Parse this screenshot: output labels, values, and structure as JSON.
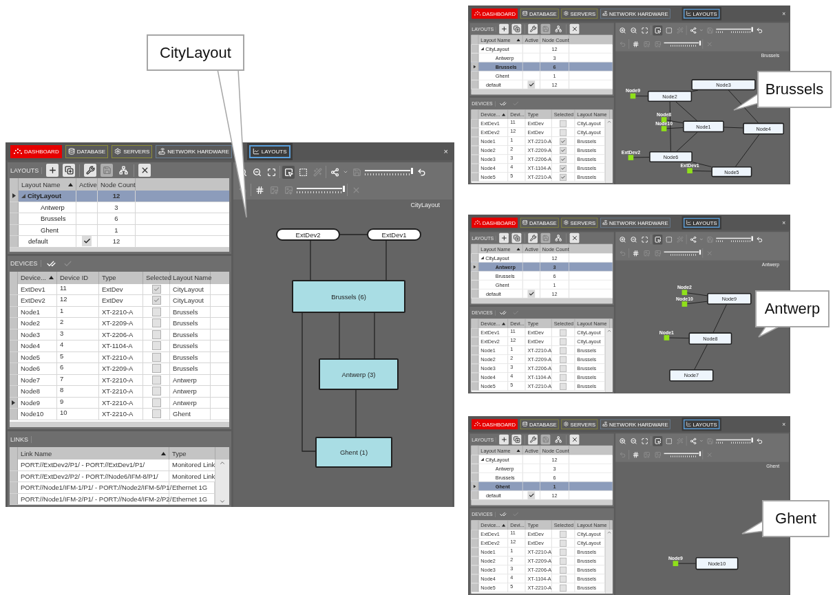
{
  "screenshots": [
    {
      "callout": "CityLayout",
      "window": {
        "tabs": [
          {
            "label": "DASHBOARD",
            "kind": "dashboard",
            "selected": false
          },
          {
            "label": "DATABASE",
            "kind": "database",
            "selected": false
          },
          {
            "label": "SERVERS",
            "kind": "servers",
            "selected": false
          },
          {
            "label": "NETWORK HARDWARE",
            "kind": "hardware",
            "selected": false
          },
          {
            "label": "LAYOUTS",
            "kind": "layouts",
            "selected": true
          }
        ],
        "close": "×",
        "layouts": {
          "title": "LAYOUTS",
          "columns": [
            "Layout Name",
            "Active",
            "Node Count"
          ],
          "rows": [
            {
              "name": "CityLayout",
              "active": false,
              "count": "12",
              "selected": true,
              "expanded": true,
              "children": [
                {
                  "name": "Antwerp",
                  "active": false,
                  "count": "3",
                  "selected": false
                },
                {
                  "name": "Brussels",
                  "active": false,
                  "count": "6",
                  "selected": false
                },
                {
                  "name": "Ghent",
                  "active": false,
                  "count": "1",
                  "selected": false
                }
              ]
            },
            {
              "name": "default",
              "active": true,
              "count": "12",
              "selected": false
            }
          ]
        },
        "devices": {
          "title": "DEVICES",
          "scrollbar": false,
          "columns": [
            "Device...",
            "Device ID",
            "Type",
            "Selected",
            "Layout Name"
          ],
          "rows": [
            {
              "name": "ExtDev1",
              "id": "11",
              "type": "ExtDev",
              "checked": true,
              "layout": "CityLayout",
              "current": false
            },
            {
              "name": "ExtDev2",
              "id": "12",
              "type": "ExtDev",
              "checked": true,
              "layout": "CityLayout",
              "current": false
            },
            {
              "name": "Node1",
              "id": "1",
              "type": "XT-2210-A",
              "checked": false,
              "layout": "Brussels",
              "current": false
            },
            {
              "name": "Node2",
              "id": "2",
              "type": "XT-2209-A",
              "checked": false,
              "layout": "Brussels",
              "current": false
            },
            {
              "name": "Node3",
              "id": "3",
              "type": "XT-2206-A",
              "checked": false,
              "layout": "Brussels",
              "current": false
            },
            {
              "name": "Node4",
              "id": "4",
              "type": "XT-1104-A",
              "checked": false,
              "layout": "Brussels",
              "current": false
            },
            {
              "name": "Node5",
              "id": "5",
              "type": "XT-2210-A",
              "checked": false,
              "layout": "Brussels",
              "current": false
            },
            {
              "name": "Node6",
              "id": "6",
              "type": "XT-2209-A",
              "checked": false,
              "layout": "Brussels",
              "current": false
            },
            {
              "name": "Node7",
              "id": "7",
              "type": "XT-2210-A",
              "checked": false,
              "layout": "Antwerp",
              "current": false
            },
            {
              "name": "Node8",
              "id": "8",
              "type": "XT-2210-A",
              "checked": false,
              "layout": "Antwerp",
              "current": false
            },
            {
              "name": "Node9",
              "id": "9",
              "type": "XT-2210-A",
              "checked": false,
              "layout": "Antwerp",
              "current": true
            },
            {
              "name": "Node10",
              "id": "10",
              "type": "XT-2210-A",
              "checked": false,
              "layout": "Ghent",
              "current": false
            }
          ]
        },
        "links": {
          "title": "LINKS",
          "columns": [
            "Link Name",
            "Type"
          ],
          "rows": [
            {
              "name": "PORT://ExtDev2/P1/ - PORT://ExtDev1/P1/",
              "type": "Monitored Link"
            },
            {
              "name": "PORT://ExtDev2/P2/ - PORT://Node6/IFM-8/P1/",
              "type": "Monitored Link"
            },
            {
              "name": "PORT://Node1/IFM-1/P1/ - PORT://Node2/IFM-5/P1/",
              "type": "Ethernet 1G"
            },
            {
              "name": "PORT://Node1/IFM-2/P1/ - PORT://Node4/IFM-2/P2/",
              "type": "Ethernet 1G"
            }
          ]
        },
        "canvas": {
          "title": "CityLayout",
          "zoom": {
            "level": 1
          },
          "size": {
            "level": 1
          },
          "nodes": [
            {
              "label": "ExtDev2",
              "kind": "pill"
            },
            {
              "label": "ExtDev1",
              "kind": "pill"
            },
            {
              "label": "Brussels (6)",
              "kind": "group"
            },
            {
              "label": "Antwerp (3)",
              "kind": "group"
            },
            {
              "label": "Ghent (1)",
              "kind": "group"
            }
          ]
        }
      }
    },
    {
      "callout": "Brussels",
      "window": {
        "tabs": [
          {
            "label": "DASHBOARD",
            "kind": "dashboard",
            "selected": false
          },
          {
            "label": "DATABASE",
            "kind": "database",
            "selected": false
          },
          {
            "label": "SERVERS",
            "kind": "servers",
            "selected": false
          },
          {
            "label": "NETWORK HARDWARE",
            "kind": "hardware",
            "selected": false
          },
          {
            "label": "LAYOUTS",
            "kind": "layouts",
            "selected": true
          }
        ],
        "close": "×",
        "layouts": {
          "title": "LAYOUTS",
          "columns": [
            "Layout Name",
            "Active",
            "Node Count"
          ],
          "rows": [
            {
              "name": "CityLayout",
              "active": false,
              "count": "12",
              "selected": false,
              "expanded": true,
              "children": [
                {
                  "name": "Antwerp",
                  "active": false,
                  "count": "3",
                  "selected": false
                },
                {
                  "name": "Brussels",
                  "active": false,
                  "count": "6",
                  "selected": true
                },
                {
                  "name": "Ghent",
                  "active": false,
                  "count": "1",
                  "selected": false
                }
              ]
            },
            {
              "name": "default",
              "active": true,
              "count": "12",
              "selected": false
            }
          ]
        },
        "devices": {
          "title": "DEVICES",
          "scrollbar": true,
          "columns": [
            "Device...",
            "Devi...",
            "Type",
            "Selected",
            "Layout Name"
          ],
          "rows": [
            {
              "name": "ExtDev1",
              "id": "11",
              "type": "ExtDev",
              "checked": false,
              "layout": "CityLayout",
              "current": false
            },
            {
              "name": "ExtDev2",
              "id": "12",
              "type": "ExtDev",
              "checked": false,
              "layout": "CityLayout",
              "current": false
            },
            {
              "name": "Node1",
              "id": "1",
              "type": "XT-2210-A",
              "checked": true,
              "layout": "Brussels",
              "current": false
            },
            {
              "name": "Node2",
              "id": "2",
              "type": "XT-2209-A",
              "checked": true,
              "layout": "Brussels",
              "current": false
            },
            {
              "name": "Node3",
              "id": "3",
              "type": "XT-2206-A",
              "checked": true,
              "layout": "Brussels",
              "current": false
            },
            {
              "name": "Node4",
              "id": "4",
              "type": "XT-1104-A",
              "checked": true,
              "layout": "Brussels",
              "current": false
            },
            {
              "name": "Node5",
              "id": "5",
              "type": "XT-2210-A",
              "checked": true,
              "layout": "Brussels",
              "current": false
            }
          ]
        },
        "canvas": {
          "title": "Brussels",
          "zoom": {
            "level": 1
          },
          "size": {
            "level": 1
          },
          "nodes": [
            {
              "label": "Node3",
              "kind": "node"
            },
            {
              "label": "Node9",
              "kind": "port"
            },
            {
              "label": "Node2",
              "kind": "node"
            },
            {
              "label": "Node8",
              "kind": "port"
            },
            {
              "label": "Node10",
              "kind": "port"
            },
            {
              "label": "Node1",
              "kind": "node"
            },
            {
              "label": "Node4",
              "kind": "node"
            },
            {
              "label": "ExtDev2",
              "kind": "port"
            },
            {
              "label": "Node6",
              "kind": "node"
            },
            {
              "label": "ExtDev1",
              "kind": "port"
            },
            {
              "label": "Node5",
              "kind": "node"
            }
          ]
        }
      }
    },
    {
      "callout": "Antwerp",
      "window": {
        "tabs": [
          {
            "label": "DASHBOARD",
            "kind": "dashboard",
            "selected": false
          },
          {
            "label": "DATABASE",
            "kind": "database",
            "selected": false
          },
          {
            "label": "SERVERS",
            "kind": "servers",
            "selected": false
          },
          {
            "label": "NETWORK HARDWARE",
            "kind": "hardware",
            "selected": false
          },
          {
            "label": "LAYOUTS",
            "kind": "layouts",
            "selected": true
          }
        ],
        "close": "×",
        "layouts": {
          "title": "LAYOUTS",
          "columns": [
            "Layout Name",
            "Active",
            "Node Count"
          ],
          "rows": [
            {
              "name": "CityLayout",
              "active": false,
              "count": "12",
              "selected": false,
              "expanded": true,
              "children": [
                {
                  "name": "Antwerp",
                  "active": false,
                  "count": "3",
                  "selected": true
                },
                {
                  "name": "Brussels",
                  "active": false,
                  "count": "6",
                  "selected": false
                },
                {
                  "name": "Ghent",
                  "active": false,
                  "count": "1",
                  "selected": false
                }
              ]
            },
            {
              "name": "default",
              "active": true,
              "count": "12",
              "selected": false
            }
          ]
        },
        "devices": {
          "title": "DEVICES",
          "scrollbar": true,
          "columns": [
            "Device...",
            "Devi...",
            "Type",
            "Selected",
            "Layout Name"
          ],
          "rows": [
            {
              "name": "ExtDev1",
              "id": "11",
              "type": "ExtDev",
              "checked": false,
              "layout": "CityLayout",
              "current": false
            },
            {
              "name": "ExtDev2",
              "id": "12",
              "type": "ExtDev",
              "checked": false,
              "layout": "CityLayout",
              "current": false
            },
            {
              "name": "Node1",
              "id": "1",
              "type": "XT-2210-A",
              "checked": false,
              "layout": "Brussels",
              "current": false
            },
            {
              "name": "Node2",
              "id": "2",
              "type": "XT-2209-A",
              "checked": false,
              "layout": "Brussels",
              "current": false
            },
            {
              "name": "Node3",
              "id": "3",
              "type": "XT-2206-A",
              "checked": false,
              "layout": "Brussels",
              "current": false
            },
            {
              "name": "Node4",
              "id": "4",
              "type": "XT-1104-A",
              "checked": false,
              "layout": "Brussels",
              "current": false
            },
            {
              "name": "Node5",
              "id": "5",
              "type": "XT-2210-A",
              "checked": false,
              "layout": "Brussels",
              "current": false
            }
          ]
        },
        "canvas": {
          "title": "Antwerp",
          "zoom": {
            "level": 1
          },
          "size": {
            "level": 1
          },
          "nodes": [
            {
              "label": "Node2",
              "kind": "port"
            },
            {
              "label": "Node10",
              "kind": "port"
            },
            {
              "label": "Node9",
              "kind": "node"
            },
            {
              "label": "Node1",
              "kind": "port"
            },
            {
              "label": "Node8",
              "kind": "node"
            },
            {
              "label": "Node7",
              "kind": "node"
            }
          ]
        }
      }
    },
    {
      "callout": "Ghent",
      "window": {
        "tabs": [
          {
            "label": "DASHBOARD",
            "kind": "dashboard",
            "selected": false
          },
          {
            "label": "DATABASE",
            "kind": "database",
            "selected": false
          },
          {
            "label": "SERVERS",
            "kind": "servers",
            "selected": false
          },
          {
            "label": "NETWORK HARDWARE",
            "kind": "hardware",
            "selected": false
          },
          {
            "label": "LAYOUTS",
            "kind": "layouts",
            "selected": true
          }
        ],
        "close": "×",
        "layouts": {
          "title": "LAYOUTS",
          "columns": [
            "Layout Name",
            "Active",
            "Node Count"
          ],
          "rows": [
            {
              "name": "CityLayout",
              "active": false,
              "count": "12",
              "selected": false,
              "expanded": true,
              "children": [
                {
                  "name": "Antwerp",
                  "active": false,
                  "count": "3",
                  "selected": false
                },
                {
                  "name": "Brussels",
                  "active": false,
                  "count": "6",
                  "selected": false
                },
                {
                  "name": "Ghent",
                  "active": false,
                  "count": "1",
                  "selected": true
                }
              ]
            },
            {
              "name": "default",
              "active": true,
              "count": "12",
              "selected": false
            }
          ]
        },
        "devices": {
          "title": "DEVICES",
          "scrollbar": true,
          "columns": [
            "Device...",
            "Devi...",
            "Type",
            "Selected",
            "Layout Name"
          ],
          "rows": [
            {
              "name": "ExtDev1",
              "id": "11",
              "type": "ExtDev",
              "checked": false,
              "layout": "CityLayout",
              "current": false
            },
            {
              "name": "ExtDev2",
              "id": "12",
              "type": "ExtDev",
              "checked": false,
              "layout": "CityLayout",
              "current": false
            },
            {
              "name": "Node1",
              "id": "1",
              "type": "XT-2210-A",
              "checked": false,
              "layout": "Brussels",
              "current": false
            },
            {
              "name": "Node2",
              "id": "2",
              "type": "XT-2209-A",
              "checked": false,
              "layout": "Brussels",
              "current": false
            },
            {
              "name": "Node3",
              "id": "3",
              "type": "XT-2206-A",
              "checked": false,
              "layout": "Brussels",
              "current": false
            },
            {
              "name": "Node4",
              "id": "4",
              "type": "XT-1104-A",
              "checked": false,
              "layout": "Brussels",
              "current": false
            },
            {
              "name": "Node5",
              "id": "5",
              "type": "XT-2210-A",
              "checked": false,
              "layout": "Brussels",
              "current": false
            }
          ]
        },
        "canvas": {
          "title": "Ghent",
          "zoom": {
            "level": 1
          },
          "size": {
            "level": 1
          },
          "nodes": [
            {
              "label": "Node9",
              "kind": "port"
            },
            {
              "label": "Node10",
              "kind": "node"
            }
          ]
        }
      }
    }
  ]
}
